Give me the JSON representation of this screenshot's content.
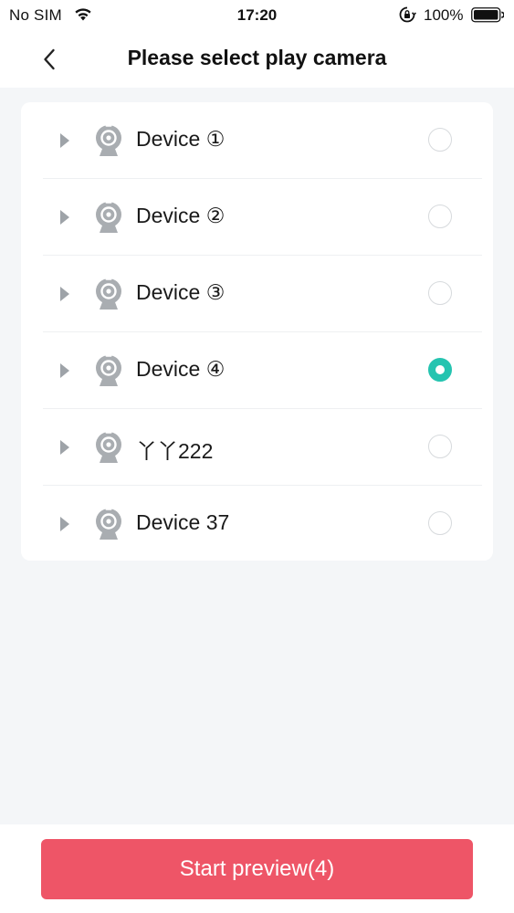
{
  "status_bar": {
    "carrier": "No SIM",
    "time": "17:20",
    "battery_percent": "100%"
  },
  "nav": {
    "title": "Please select play camera"
  },
  "devices": [
    {
      "name": "Device ①",
      "selected": false
    },
    {
      "name": "Device ②",
      "selected": false
    },
    {
      "name": "Device ③",
      "selected": false
    },
    {
      "name": "Device ④",
      "selected": true
    },
    {
      "name": "丫丫222",
      "selected": false
    },
    {
      "name": "Device 37",
      "selected": false
    }
  ],
  "footer": {
    "start_button_label": "Start preview(4)"
  },
  "colors": {
    "accent_selected": "#25c4b0",
    "primary_button": "#ee5567",
    "background": "#f4f6f8"
  }
}
